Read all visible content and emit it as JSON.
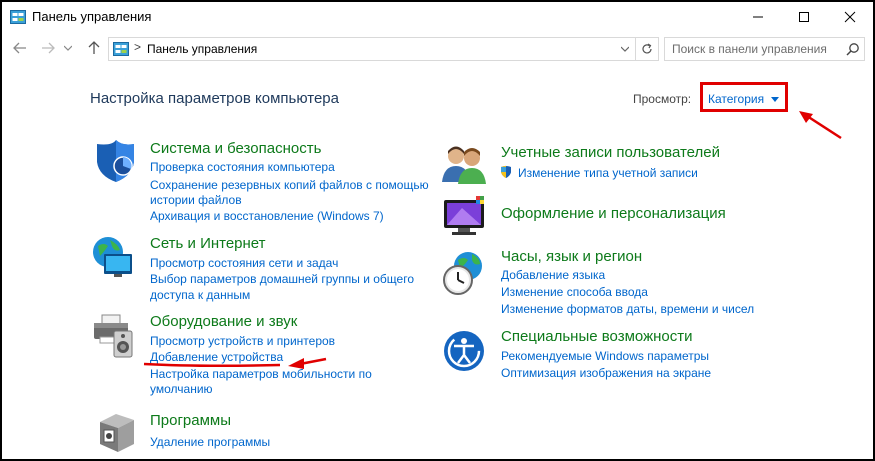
{
  "window": {
    "title": "Панель управления"
  },
  "address_bar": {
    "path": "Панель управления",
    "separator": ">",
    "search_placeholder": "Поиск в панели управления"
  },
  "header": {
    "heading": "Настройка параметров компьютера",
    "view_label": "Просмотр:",
    "view_value": "Категория"
  },
  "categories": {
    "security": {
      "title": "Система и безопасность",
      "icon": "shield-icon",
      "links": [
        "Проверка состояния компьютера",
        "Сохранение резервных копий файлов с помощью",
        "истории файлов",
        "Архивация и восстановление (Windows 7)"
      ]
    },
    "network": {
      "title": "Сеть и Интернет",
      "icon": "network-globe-icon",
      "links": [
        "Просмотр состояния сети и задач",
        "Выбор параметров домашней группы и общего",
        "доступа к данным"
      ]
    },
    "hardware": {
      "title": "Оборудование и звук",
      "icon": "printer-speaker-icon",
      "links": [
        "Просмотр устройств и принтеров",
        "Добавление устройства",
        "Настройка параметров мобильности по",
        "умолчанию"
      ]
    },
    "programs": {
      "title": "Программы",
      "icon": "programs-box-icon",
      "links": [
        "Удаление программы"
      ]
    },
    "accounts": {
      "title": "Учетные записи пользователей",
      "icon": "users-icon",
      "links": [
        "Изменение типа учетной записи"
      ]
    },
    "appearance": {
      "title": "Оформление и персонализация",
      "icon": "monitor-palette-icon",
      "links": []
    },
    "clock": {
      "title": "Часы, язык и регион",
      "icon": "clock-globe-icon",
      "links": [
        "Добавление языка",
        "Изменение способа ввода",
        "Изменение форматов даты, времени и чисел"
      ]
    },
    "ease": {
      "title": "Специальные возможности",
      "icon": "ease-of-access-icon",
      "links": [
        "Рекомендуемые Windows параметры",
        "Оптимизация изображения на экране"
      ]
    }
  },
  "colors": {
    "category_title": "#0d7a1a",
    "link": "#0066cc",
    "heading": "#1e395b",
    "annotation_red": "#e00000"
  }
}
